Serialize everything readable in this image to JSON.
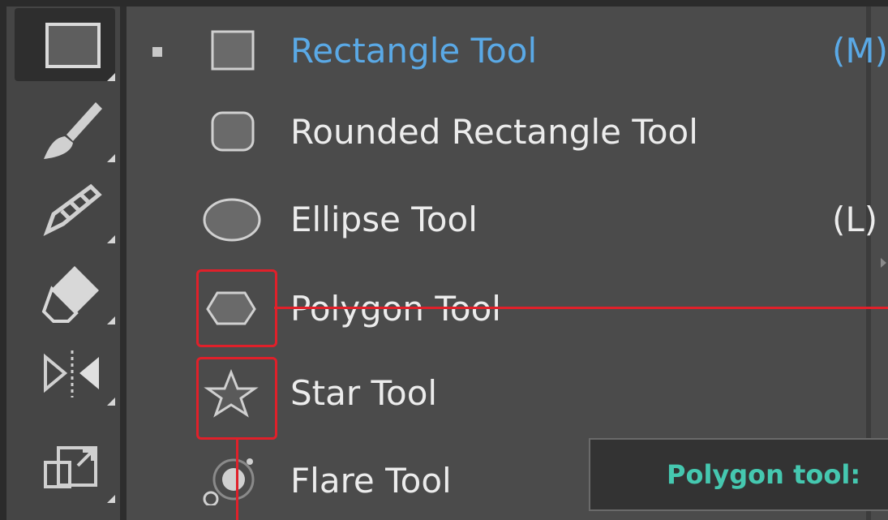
{
  "toolbar": {
    "tools": [
      {
        "name": "rectangle-tool",
        "icon": "rectangle-icon",
        "active": true
      },
      {
        "name": "paintbrush-tool",
        "icon": "paintbrush-icon"
      },
      {
        "name": "shaper-tool",
        "icon": "pencil-icon"
      },
      {
        "name": "eraser-tool",
        "icon": "eraser-icon"
      },
      {
        "name": "reflect-tool",
        "icon": "reflect-icon"
      },
      {
        "name": "scale-tool",
        "icon": "scale-icon"
      }
    ]
  },
  "flyout": {
    "items": [
      {
        "label": "Rectangle Tool",
        "shortcut": "(M)",
        "icon": "rectangle-icon",
        "selected": true
      },
      {
        "label": "Rounded Rectangle Tool",
        "shortcut": "",
        "icon": "rounded-rectangle-icon"
      },
      {
        "label": "Ellipse Tool",
        "shortcut": "(L)",
        "icon": "ellipse-icon"
      },
      {
        "label": "Polygon Tool",
        "shortcut": "",
        "icon": "polygon-icon"
      },
      {
        "label": "Star Tool",
        "shortcut": "",
        "icon": "star-icon"
      },
      {
        "label": "Flare Tool",
        "shortcut": "",
        "icon": "flare-icon"
      }
    ]
  },
  "tooltip": {
    "text": "Polygon tool:"
  },
  "colors": {
    "selected_text": "#5aa9e6",
    "highlight": "#e0202a",
    "tooltip_text": "#45c8b0"
  }
}
